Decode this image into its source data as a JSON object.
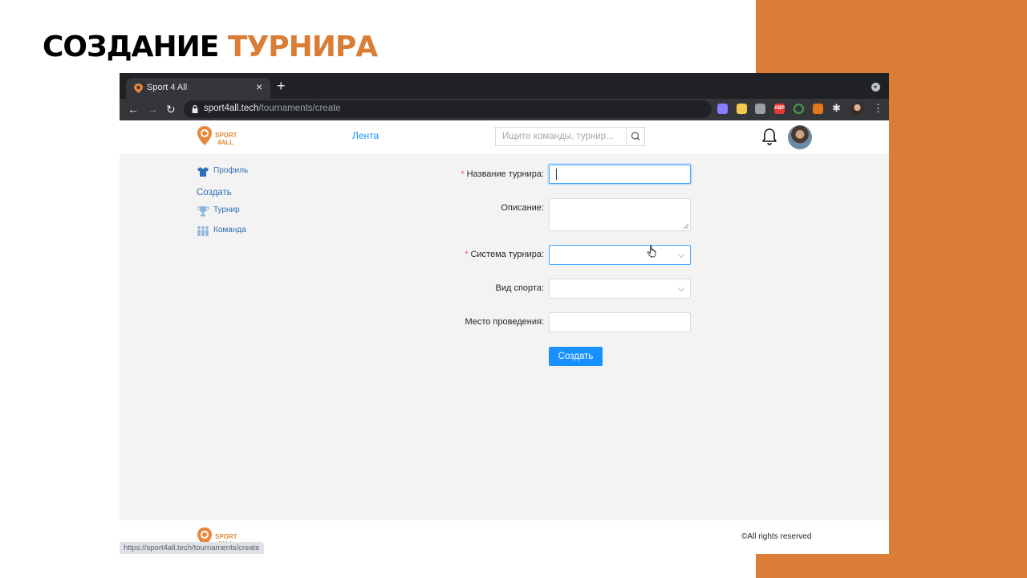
{
  "slide": {
    "title_black": "СОЗДАНИЕ",
    "title_accent": "ТУРНИРА",
    "accent_color": "#d97d37"
  },
  "browser": {
    "tab_title": "Sport 4 All",
    "tab_close": "×",
    "new_tab": "+",
    "url_host": "sport4all.tech",
    "url_path": "/tournaments/create",
    "status_url": "https://sport4all.tech/tournaments/create",
    "extensions": [
      {
        "name": "ext-globe",
        "color": "#8a7cff"
      },
      {
        "name": "ext-lock",
        "color": "#f2c94c"
      },
      {
        "name": "ext-box",
        "color": "#9aa0a6"
      },
      {
        "name": "ext-abp",
        "color": "#e53935",
        "label": "ABP"
      },
      {
        "name": "ext-ring",
        "color": "#43a047"
      },
      {
        "name": "ext-fox",
        "color": "#e2761b"
      }
    ]
  },
  "site": {
    "logo_text_1": "SPORT",
    "logo_text_2": "4ALL",
    "nav_feed": "Лента",
    "search_placeholder": "Ищите команды, турнир...",
    "brand_color": "#1890ff"
  },
  "sidebar": {
    "profile": "Профиль",
    "create_section": "Создать",
    "tournament": "Турнир",
    "team": "Команда"
  },
  "form": {
    "required_mark": "*",
    "name_label": "Название турнира",
    "description_label": "Описание",
    "system_label": "Система турнира",
    "sport_label": "Вид спорта",
    "venue_label": "Место проведения",
    "colon": ":",
    "name_value": "",
    "description_value": "",
    "system_value": "",
    "sport_value": "",
    "venue_value": "",
    "submit_label": "Создать"
  },
  "footer": {
    "copyright": "©All rights reserved"
  }
}
